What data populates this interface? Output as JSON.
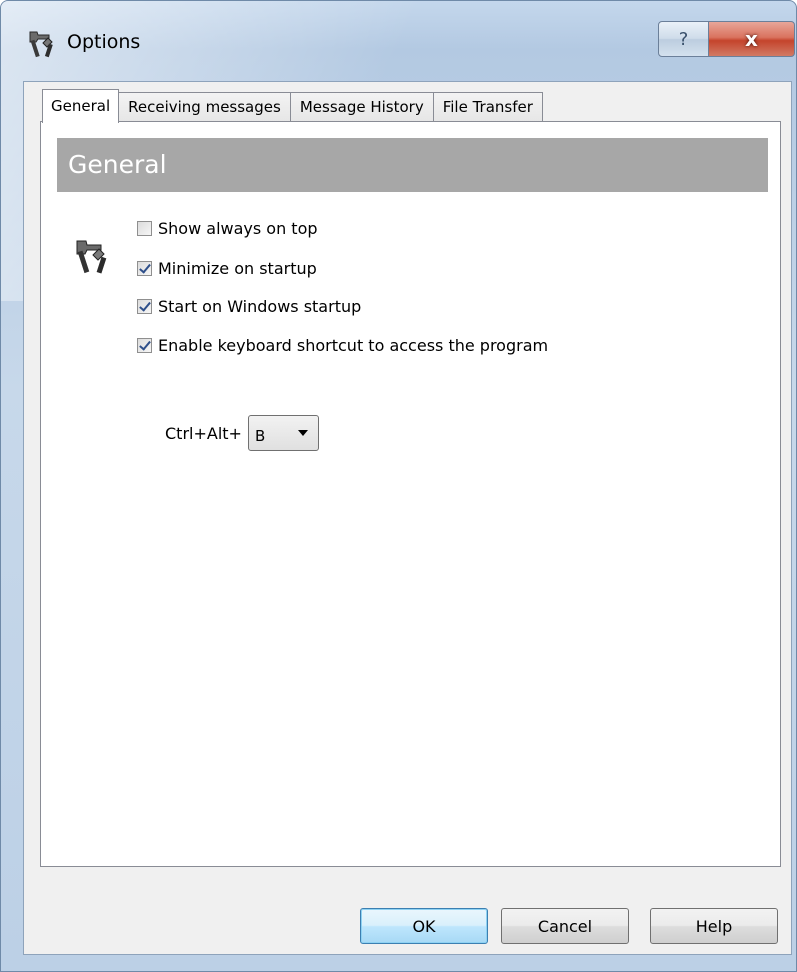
{
  "window": {
    "title": "Options",
    "help_caption": "?",
    "close_caption": "x"
  },
  "tabs": [
    {
      "label": "General",
      "active": true
    },
    {
      "label": "Receiving messages",
      "active": false
    },
    {
      "label": "Message History",
      "active": false
    },
    {
      "label": "File Transfer",
      "active": false
    }
  ],
  "general": {
    "header": "General",
    "icon": "tools-icon",
    "options": [
      {
        "label": "Show always on top",
        "checked": false
      },
      {
        "label": "Minimize on startup",
        "checked": true
      },
      {
        "label": "Start on Windows startup",
        "checked": true
      },
      {
        "label": "Enable keyboard shortcut to access the program",
        "checked": true
      }
    ],
    "shortcut": {
      "label": "Ctrl+Alt+",
      "selected_key": "B"
    }
  },
  "buttons": {
    "ok": "OK",
    "cancel": "Cancel",
    "help": "Help"
  },
  "colors": {
    "section_header_bg": "#a7a7a7",
    "close_button": "#c4442c",
    "default_button_border": "#3c7fb1"
  }
}
